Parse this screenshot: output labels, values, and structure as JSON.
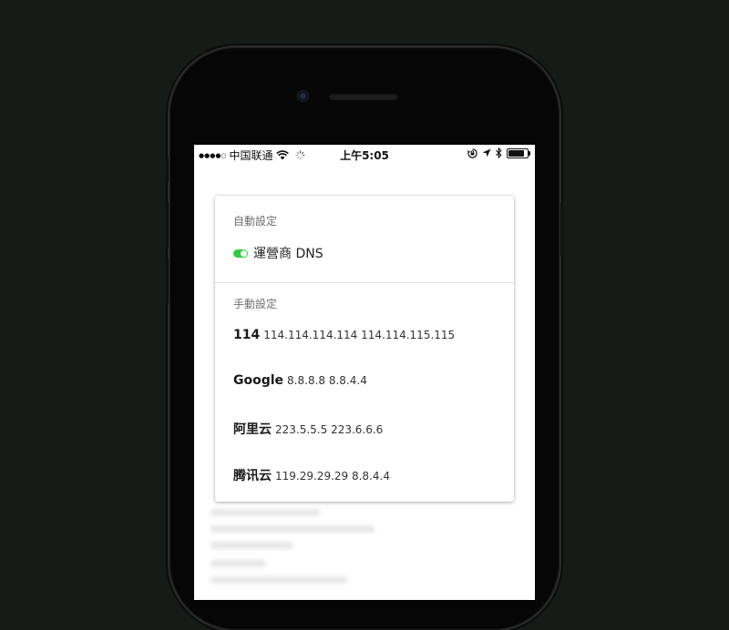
{
  "statusbar": {
    "signal": "●●●●○",
    "carrier": "中国联通",
    "time": "上午5:05"
  },
  "card": {
    "auto_title": "自動設定",
    "auto_option": "運營商 DNS",
    "auto_enabled": true,
    "manual_title": "手動設定",
    "servers": [
      {
        "name": "114",
        "addresses": "114.114.114.114 114.114.115.115"
      },
      {
        "name": "Google",
        "addresses": "8.8.8.8 8.8.4.4"
      },
      {
        "name": "阿里云",
        "addresses": "223.5.5.5 223.6.6.6"
      },
      {
        "name": "腾讯云",
        "addresses": "119.29.29.29 8.8.4.4"
      }
    ]
  },
  "colors": {
    "background": "#151b17",
    "toggle_on": "#2ecc40",
    "screen": "#ffffff"
  },
  "icons": [
    "wifi-icon",
    "activity-spinner-icon",
    "orientation-lock-icon",
    "location-arrow-icon",
    "bluetooth-icon",
    "battery-icon",
    "front-camera-icon"
  ]
}
